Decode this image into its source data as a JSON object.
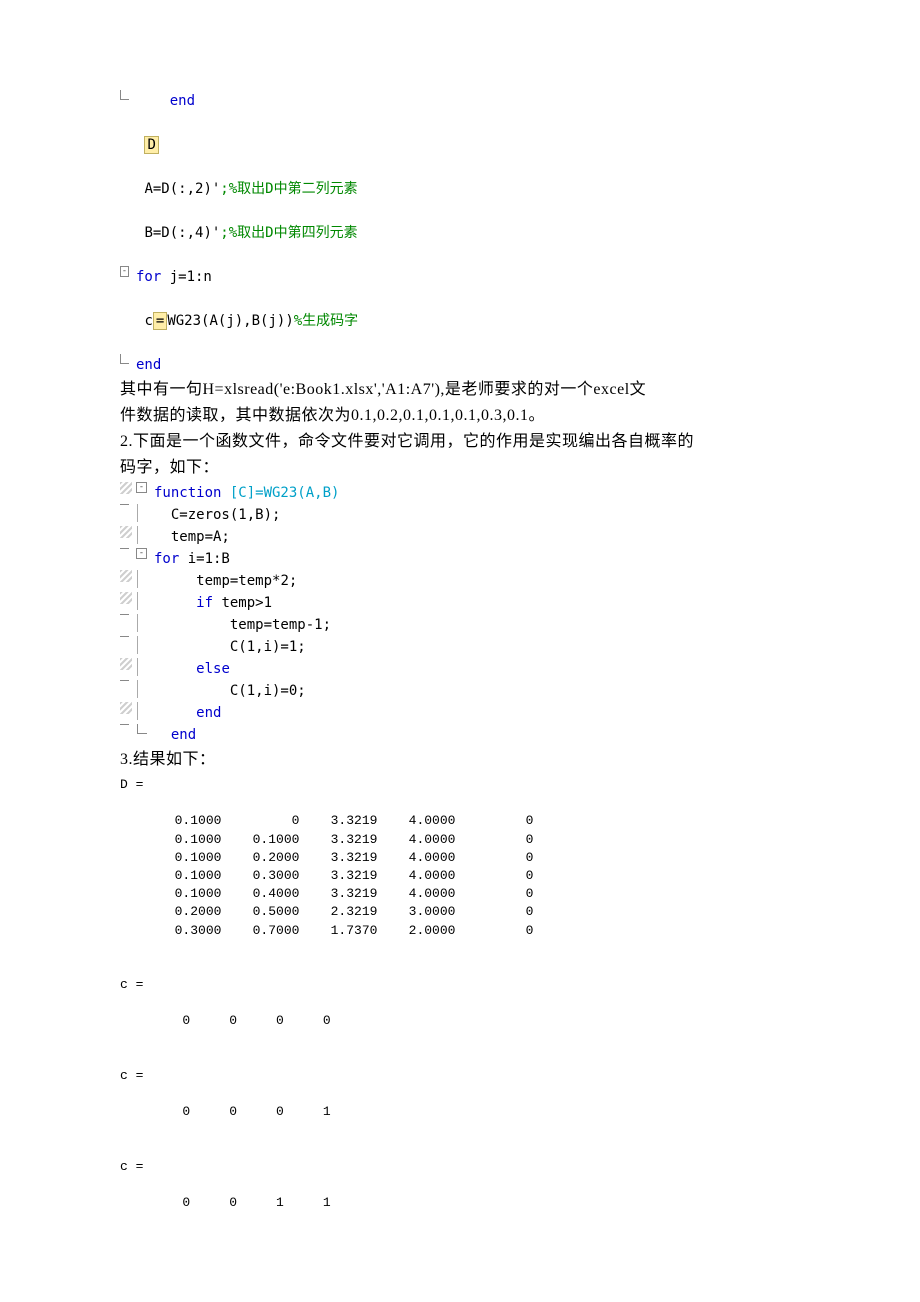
{
  "code_block1": {
    "lines": [
      {
        "gutter": "corner",
        "indent": "    ",
        "tokens": [
          {
            "t": "end",
            "cls": "kw-blue"
          }
        ]
      },
      {
        "gutter": "",
        "indent": "",
        "tokens": []
      },
      {
        "gutter": "",
        "indent": " ",
        "tokens": [
          {
            "t": "D",
            "cls": "hl-box"
          }
        ]
      },
      {
        "gutter": "",
        "indent": "",
        "tokens": []
      },
      {
        "gutter": "",
        "indent": " ",
        "tokens": [
          {
            "t": "A=D(:,2)'",
            "cls": ""
          },
          {
            "t": ";%取出D中第二列元素",
            "cls": "cmt-green"
          }
        ]
      },
      {
        "gutter": "",
        "indent": "",
        "tokens": []
      },
      {
        "gutter": "",
        "indent": " ",
        "tokens": [
          {
            "t": "B=D(:,4)'",
            "cls": ""
          },
          {
            "t": ";%取出D中第四列元素",
            "cls": "cmt-green"
          }
        ]
      },
      {
        "gutter": "",
        "indent": "",
        "tokens": []
      },
      {
        "gutter": "box",
        "indent": "",
        "tokens": [
          {
            "t": "for ",
            "cls": "kw-blue"
          },
          {
            "t": "j=1:n",
            "cls": ""
          }
        ]
      },
      {
        "gutter": "",
        "indent": "",
        "tokens": []
      },
      {
        "gutter": "",
        "indent": " ",
        "tokens": [
          {
            "t": "c",
            "cls": ""
          },
          {
            "t": "=",
            "cls": "hl-box"
          },
          {
            "t": "WG23(A(j),B(j))",
            "cls": ""
          },
          {
            "t": "%生成码字",
            "cls": "cmt-green"
          }
        ]
      },
      {
        "gutter": "",
        "indent": "",
        "tokens": []
      },
      {
        "gutter": "corner",
        "indent": "",
        "tokens": [
          {
            "t": "end",
            "cls": "kw-blue"
          }
        ]
      }
    ]
  },
  "paragraph1": {
    "l1": "其中有一句H=xlsread('e:Book1.xlsx','A1:A7'),是老师要求的对一个excel文",
    "l2": "件数据的读取，其中数据依次为0.1,0.2,0.1,0.1,0.1,0.3,0.1。",
    "l3": "2.下面是一个函数文件，命令文件要对它调用，它的作用是实现编出各自概率的",
    "l4": "码字，如下："
  },
  "code_block2": {
    "lines": [
      {
        "gutter": "hatch",
        "fold": "box",
        "indent": "",
        "tokens": [
          {
            "t": "function ",
            "cls": "kw-blue"
          },
          {
            "t": "[C]=WG23(A,B)",
            "cls": "kw-cyan"
          }
        ]
      },
      {
        "gutter": "dash",
        "fold": "pipe",
        "indent": "  ",
        "tokens": [
          {
            "t": "C=zeros(1,B);",
            "cls": ""
          }
        ]
      },
      {
        "gutter": "hatch",
        "fold": "pipe",
        "indent": "  ",
        "tokens": [
          {
            "t": "temp=A;",
            "cls": ""
          }
        ]
      },
      {
        "gutter": "dash",
        "fold": "box",
        "indent": "",
        "tokens": [
          {
            "t": "for ",
            "cls": "kw-blue"
          },
          {
            "t": "i=1:B",
            "cls": ""
          }
        ]
      },
      {
        "gutter": "hatch",
        "fold": "pipe",
        "indent": "     ",
        "tokens": [
          {
            "t": "temp=temp*2;",
            "cls": ""
          }
        ]
      },
      {
        "gutter": "hatch",
        "fold": "pipe",
        "indent": "     ",
        "tokens": [
          {
            "t": "if ",
            "cls": "kw-blue"
          },
          {
            "t": "temp>1",
            "cls": ""
          }
        ]
      },
      {
        "gutter": "dash",
        "fold": "pipe",
        "indent": "         ",
        "tokens": [
          {
            "t": "temp=temp-1;",
            "cls": ""
          }
        ]
      },
      {
        "gutter": "dash",
        "fold": "pipe",
        "indent": "         ",
        "tokens": [
          {
            "t": "C(1,i)=1;",
            "cls": ""
          }
        ]
      },
      {
        "gutter": "hatch",
        "fold": "pipe",
        "indent": "     ",
        "tokens": [
          {
            "t": "else",
            "cls": "kw-blue"
          }
        ]
      },
      {
        "gutter": "dash",
        "fold": "pipe",
        "indent": "         ",
        "tokens": [
          {
            "t": "C(1,i)=0;",
            "cls": ""
          }
        ]
      },
      {
        "gutter": "hatch",
        "fold": "pipe",
        "indent": "     ",
        "tokens": [
          {
            "t": "end",
            "cls": "kw-blue"
          }
        ]
      },
      {
        "gutter": "dash",
        "fold": "corner",
        "indent": "  ",
        "tokens": [
          {
            "t": "end",
            "cls": "kw-blue"
          }
        ]
      }
    ]
  },
  "paragraph2": "3.结果如下：",
  "output": {
    "D_header": "D =",
    "D_rows": [
      [
        "0.1000",
        "0",
        "3.3219",
        "4.0000",
        "0"
      ],
      [
        "0.1000",
        "0.1000",
        "3.3219",
        "4.0000",
        "0"
      ],
      [
        "0.1000",
        "0.2000",
        "3.3219",
        "4.0000",
        "0"
      ],
      [
        "0.1000",
        "0.3000",
        "3.3219",
        "4.0000",
        "0"
      ],
      [
        "0.1000",
        "0.4000",
        "3.3219",
        "4.0000",
        "0"
      ],
      [
        "0.2000",
        "0.5000",
        "2.3219",
        "3.0000",
        "0"
      ],
      [
        "0.3000",
        "0.7000",
        "1.7370",
        "2.0000",
        "0"
      ]
    ],
    "c_blocks": [
      {
        "header": "c =",
        "row": [
          "0",
          "0",
          "0",
          "0"
        ]
      },
      {
        "header": "c =",
        "row": [
          "0",
          "0",
          "0",
          "1"
        ]
      },
      {
        "header": "c =",
        "row": [
          "0",
          "0",
          "1",
          "1"
        ]
      }
    ]
  }
}
